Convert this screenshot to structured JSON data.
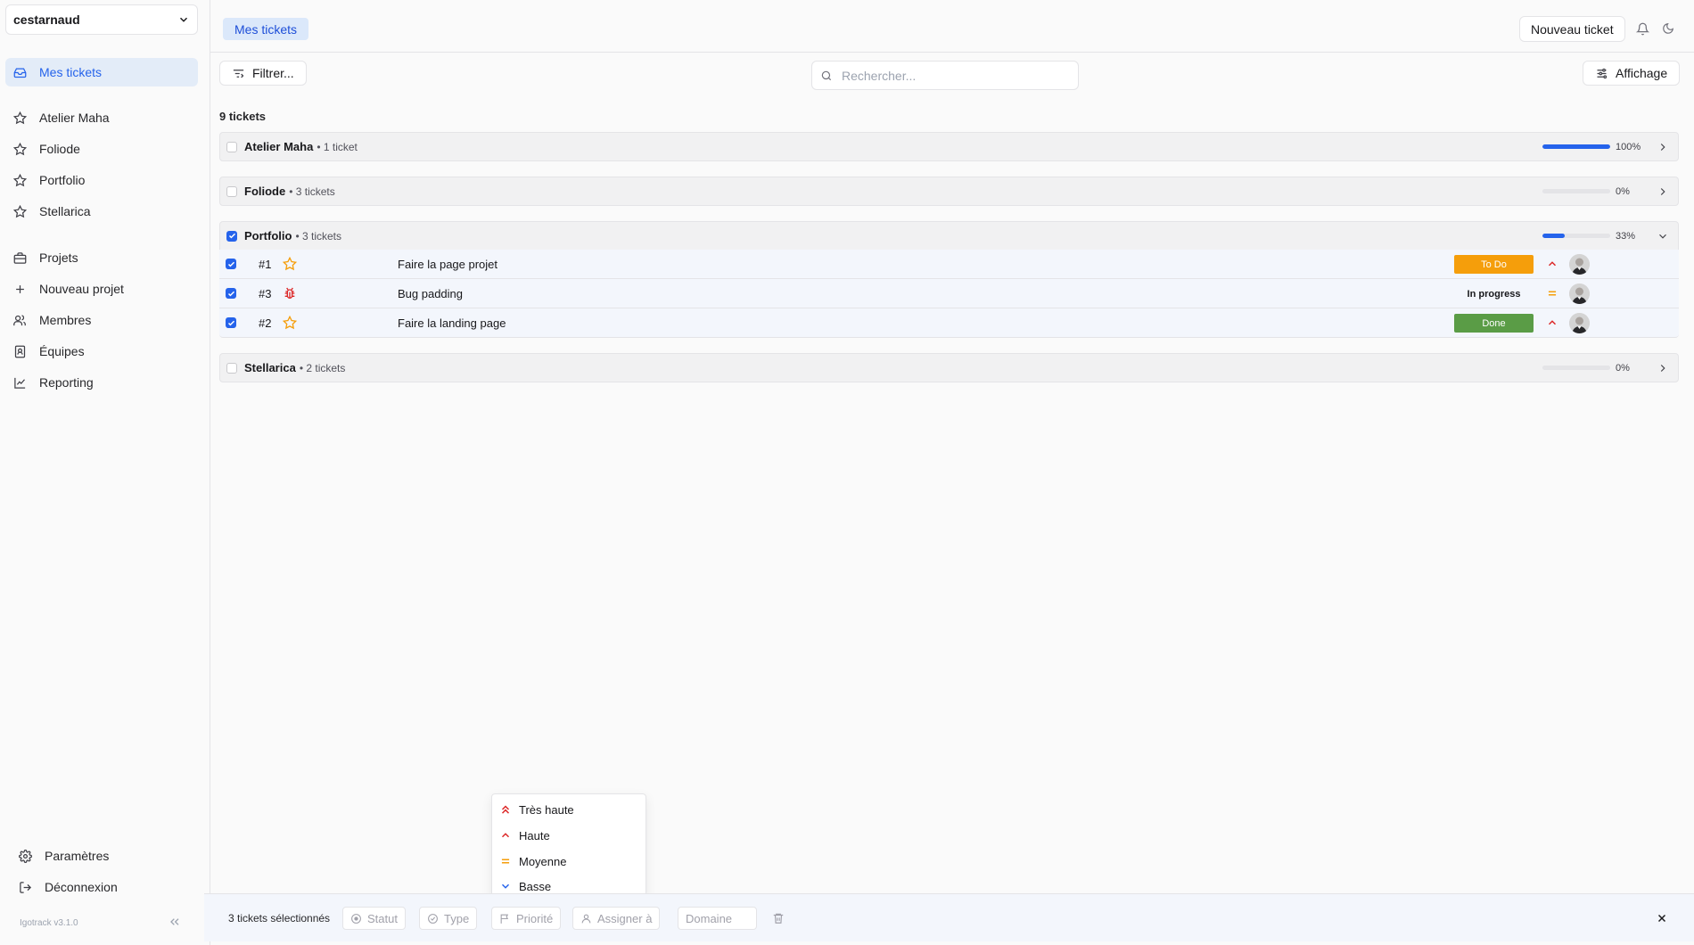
{
  "sidebar": {
    "workspace": "cestarnaud",
    "items": [
      {
        "label": "Mes tickets",
        "icon": "inbox-icon"
      },
      {
        "label": "Atelier Maha",
        "icon": "star-icon"
      },
      {
        "label": "Foliode",
        "icon": "star-icon"
      },
      {
        "label": "Portfolio",
        "icon": "star-icon"
      },
      {
        "label": "Stellarica",
        "icon": "star-icon"
      },
      {
        "label": "Projets",
        "icon": "briefcase-icon"
      },
      {
        "label": "Nouveau projet",
        "icon": "plus-icon"
      },
      {
        "label": "Membres",
        "icon": "users-icon"
      },
      {
        "label": "Équipes",
        "icon": "contacts-icon"
      },
      {
        "label": "Reporting",
        "icon": "chart-icon"
      }
    ],
    "settings": "Paramètres",
    "logout": "Déconnexion",
    "version": "Igotrack v3.1.0"
  },
  "header": {
    "tab": "Mes tickets",
    "new_ticket": "Nouveau ticket"
  },
  "toolbar": {
    "filter": "Filtrer...",
    "search_placeholder": "Rechercher...",
    "display": "Affichage"
  },
  "ticket_count": "9 tickets",
  "groups": [
    {
      "name": "Atelier Maha",
      "sub": "• 1 ticket",
      "progress": 100,
      "pct": "100%",
      "checked": false,
      "expanded": false
    },
    {
      "name": "Foliode",
      "sub": "• 3 tickets",
      "progress": 0,
      "pct": "0%",
      "checked": false,
      "expanded": false
    },
    {
      "name": "Portfolio",
      "sub": "• 3 tickets",
      "progress": 33,
      "pct": "33%",
      "checked": true,
      "expanded": true
    },
    {
      "name": "Stellarica",
      "sub": "• 2 tickets",
      "progress": 0,
      "pct": "0%",
      "checked": false,
      "expanded": false
    }
  ],
  "tickets": [
    {
      "id": "#1",
      "type": "star-icon",
      "title": "Faire la page projet",
      "status": "To Do",
      "status_color": "#f59e0b",
      "priority": "haute"
    },
    {
      "id": "#3",
      "type": "bug-icon",
      "title": "Bug padding",
      "status": "In progress",
      "status_color": "transparent",
      "priority": "moyenne"
    },
    {
      "id": "#2",
      "type": "star-icon",
      "title": "Faire la landing page",
      "status": "Done",
      "status_color": "#5a9c46",
      "priority": "haute"
    }
  ],
  "bulk": {
    "selected": "3 tickets sélectionnés",
    "statut": "Statut",
    "type": "Type",
    "priorite": "Priorité",
    "assigner": "Assigner à",
    "domaine": "Domaine"
  },
  "priority_menu": [
    "Très haute",
    "Haute",
    "Moyenne",
    "Basse"
  ],
  "colors": {
    "accent": "#2563eb",
    "todo": "#f59e0b",
    "done": "#5a9c46",
    "high": "#dc2626",
    "medium": "#f59e0b"
  }
}
